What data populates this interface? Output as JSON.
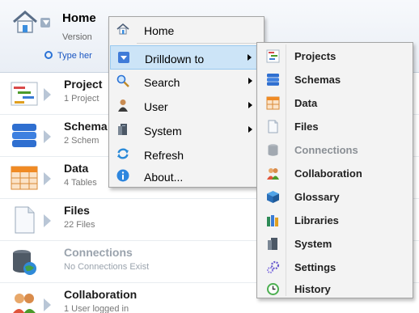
{
  "header": {
    "title": "Home",
    "version": "Version",
    "search_placeholder": "Type her"
  },
  "list": [
    {
      "title": "Project",
      "sub": "1 Project",
      "icon": "projects-icon",
      "enabled": true
    },
    {
      "title": "Schema",
      "sub": "2 Schem",
      "icon": "schemas-icon",
      "enabled": true
    },
    {
      "title": "Data",
      "sub": "4 Tables",
      "icon": "data-icon",
      "enabled": true
    },
    {
      "title": "Files",
      "sub": "22 Files",
      "icon": "files-icon",
      "enabled": true
    },
    {
      "title": "Connections",
      "sub": "No Connections Exist",
      "icon": "connections-icon",
      "enabled": false
    },
    {
      "title": "Collaboration",
      "sub": "1 User logged in",
      "icon": "collaboration-icon",
      "enabled": true
    }
  ],
  "menu": {
    "items": [
      {
        "label": "Home",
        "icon": "home-icon",
        "submenu": false
      },
      {
        "label": "Drilldown to",
        "icon": "drilldown-icon",
        "submenu": true,
        "active": true
      },
      {
        "label": "Search",
        "icon": "search-icon",
        "submenu": true
      },
      {
        "label": "User",
        "icon": "user-icon",
        "submenu": true
      },
      {
        "label": "System",
        "icon": "system-icon",
        "submenu": true
      },
      {
        "label": "Refresh",
        "icon": "refresh-icon",
        "submenu": false
      },
      {
        "label": "About...",
        "icon": "info-icon",
        "submenu": false
      }
    ]
  },
  "submenu": {
    "items": [
      {
        "label": "Projects",
        "icon": "projects-icon",
        "enabled": true
      },
      {
        "label": "Schemas",
        "icon": "schemas-icon",
        "enabled": true
      },
      {
        "label": "Data",
        "icon": "data-icon",
        "enabled": true
      },
      {
        "label": "Files",
        "icon": "files-icon",
        "enabled": true
      },
      {
        "label": "Connections",
        "icon": "connections-icon",
        "enabled": false
      },
      {
        "label": "Collaboration",
        "icon": "collaboration-icon",
        "enabled": true
      },
      {
        "label": "Glossary",
        "icon": "glossary-icon",
        "enabled": true
      },
      {
        "label": "Libraries",
        "icon": "libraries-icon",
        "enabled": true
      },
      {
        "label": "System",
        "icon": "system-icon",
        "enabled": true
      },
      {
        "label": "Settings",
        "icon": "settings-icon",
        "enabled": true
      },
      {
        "label": "History",
        "icon": "history-icon",
        "enabled": true
      }
    ]
  },
  "colors": {
    "menu_highlight": "#cce4f7",
    "link_blue": "#1a56c2",
    "disabled_text": "#9aa3ad"
  }
}
